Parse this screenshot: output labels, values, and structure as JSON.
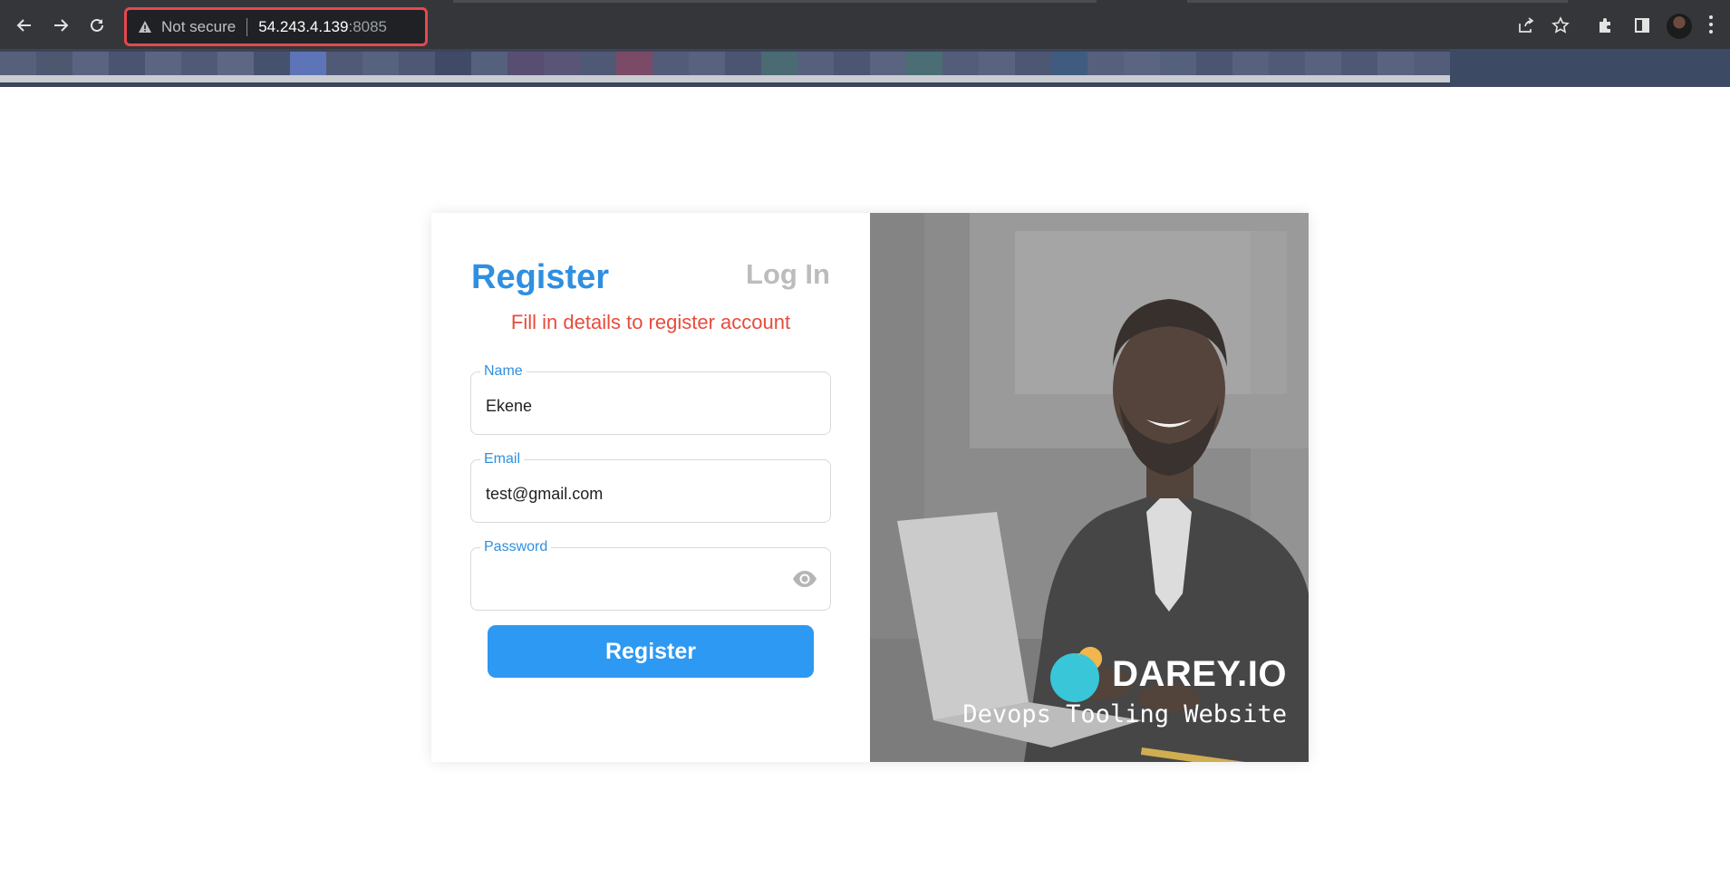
{
  "browser": {
    "security_label": "Not secure",
    "host": "54.243.4.139",
    "port": ":8085"
  },
  "form": {
    "tab_register": "Register",
    "tab_login": "Log In",
    "subtitle": "Fill in details to register account",
    "fields": {
      "name": {
        "label": "Name",
        "value": "Ekene"
      },
      "email": {
        "label": "Email",
        "value": "test@gmail.com"
      },
      "password": {
        "label": "Password",
        "value": ""
      }
    },
    "submit_label": "Register"
  },
  "branding": {
    "name": "DAREY.IO",
    "tagline": "Devops Tooling Website"
  },
  "colors": {
    "accent": "#2f8fe0",
    "button": "#2d99f2",
    "subtitle": "#e74c3c",
    "inactive_tab": "#bcbcbc",
    "highlight_border": "#e5484d"
  },
  "icons": {
    "nav": [
      "back-arrow-icon",
      "forward-arrow-icon",
      "reload-icon"
    ],
    "omnibox": "warning-triangle-icon",
    "toolbar": [
      "share-icon",
      "star-icon",
      "extensions-puzzle-icon",
      "side-panel-icon",
      "profile-avatar",
      "more-menu-icon"
    ],
    "password": "eye-icon"
  }
}
